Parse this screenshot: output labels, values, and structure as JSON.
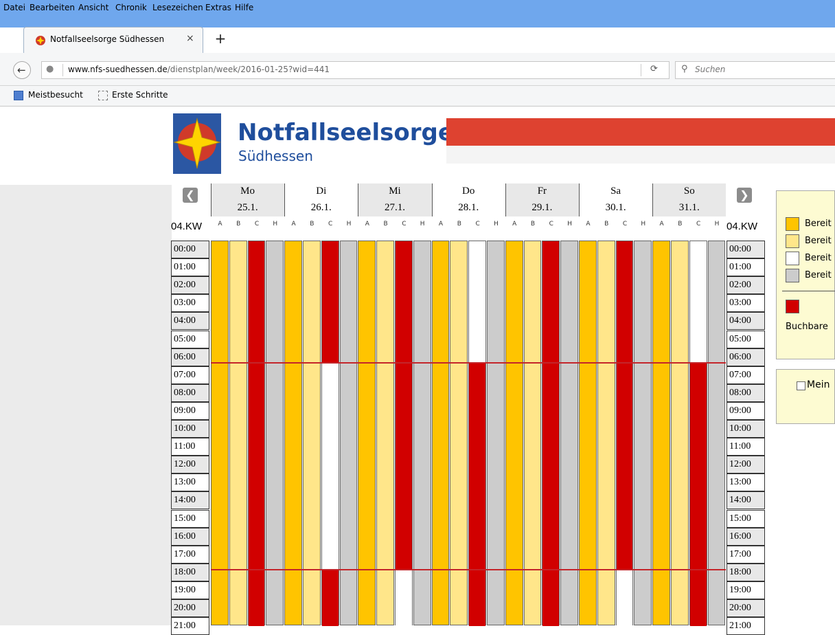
{
  "menu": [
    "Datei",
    "Bearbeiten",
    "Ansicht",
    "Chronik",
    "Lesezeichen",
    "Extras",
    "Hilfe"
  ],
  "tab": {
    "title": "Notfallseelsorge Südhessen",
    "close": "×",
    "new_tab": "+"
  },
  "urlbar": {
    "domain": "www.nfs-suedhessen.de",
    "path": "/dienstplan/week/2016-01-25?wid=441"
  },
  "search": {
    "placeholder": "Suchen"
  },
  "bookmarks": [
    "Meistbesucht",
    "Erste Schritte"
  ],
  "brand": {
    "title": "Notfallseelsorge",
    "subtitle": "Südhessen"
  },
  "week": {
    "label": "04.KW",
    "columns": [
      "A",
      "B",
      "C",
      "H"
    ],
    "days": [
      {
        "name": "Mo",
        "date": "25.1."
      },
      {
        "name": "Di",
        "date": "26.1."
      },
      {
        "name": "Mi",
        "date": "27.1."
      },
      {
        "name": "Do",
        "date": "28.1."
      },
      {
        "name": "Fr",
        "date": "29.1."
      },
      {
        "name": "Sa",
        "date": "30.1."
      },
      {
        "name": "So",
        "date": "31.1."
      }
    ],
    "hours": [
      "00:00",
      "01:00",
      "02:00",
      "03:00",
      "04:00",
      "05:00",
      "06:00",
      "07:00",
      "08:00",
      "09:00",
      "10:00",
      "11:00",
      "12:00",
      "13:00",
      "14:00",
      "15:00",
      "16:00",
      "17:00",
      "18:00",
      "19:00",
      "20:00",
      "21:00"
    ]
  },
  "colors": {
    "A": "#ffc400",
    "B": "#ffe68a",
    "C_booked": "#d10000",
    "C_free": "#ffffff",
    "H": "#cccccc",
    "line": "#c4252a"
  },
  "schedule_C": [
    [
      "booked",
      "booked",
      "booked"
    ],
    [
      "booked",
      "free",
      "booked"
    ],
    [
      "booked",
      "booked",
      "free"
    ],
    [
      "free",
      "booked",
      "booked"
    ],
    [
      "booked",
      "booked",
      "booked"
    ],
    [
      "booked",
      "booked",
      "free"
    ],
    [
      "free",
      "booked",
      "booked"
    ]
  ],
  "legend": {
    "items": [
      "Bereit",
      "Bereit",
      "Bereit",
      "Bereit"
    ],
    "bookable": "Buchbare",
    "checkbox": "Mein"
  }
}
